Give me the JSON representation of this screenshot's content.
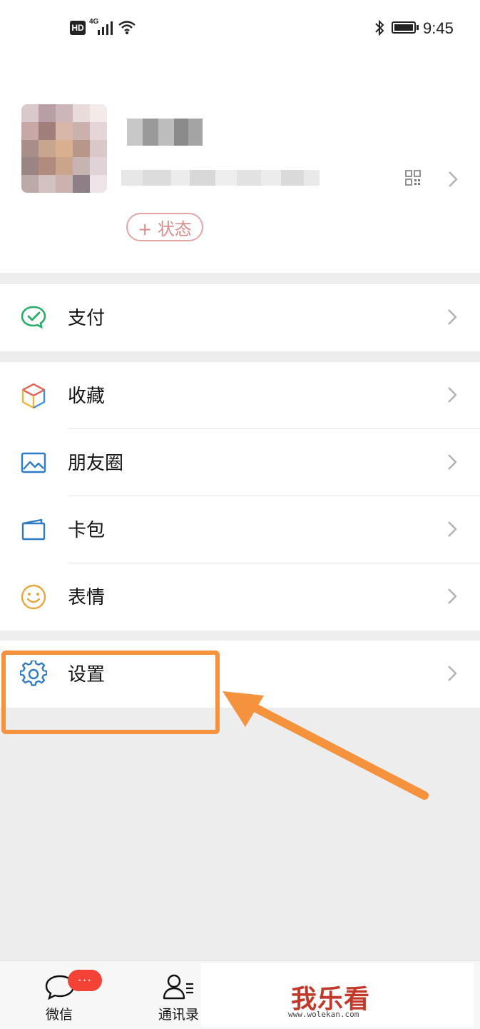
{
  "status_bar": {
    "hd": "HD",
    "network": "4G",
    "time": "9:45"
  },
  "profile": {
    "status_button": "+ 状态",
    "qr_icon": "qr-code-icon",
    "chevron_icon": "chevron-right-icon"
  },
  "menu": {
    "pay": {
      "label": "支付",
      "icon": "wechat-pay-icon",
      "color": "#2aae67"
    },
    "favorites": {
      "label": "收藏",
      "icon": "favorites-cube-icon"
    },
    "moments": {
      "label": "朋友圈",
      "icon": "moments-photo-icon",
      "color": "#2d7bc4"
    },
    "cards": {
      "label": "卡包",
      "icon": "card-wallet-icon",
      "color": "#2d7bc4"
    },
    "stickers": {
      "label": "表情",
      "icon": "smiley-icon",
      "color": "#e7a63b"
    },
    "settings": {
      "label": "设置",
      "icon": "gear-icon",
      "color": "#2d7bc4"
    }
  },
  "bottom_nav": {
    "chats": {
      "label": "微信",
      "badge": "···"
    },
    "contacts": {
      "label": "通讯录"
    }
  },
  "watermark": {
    "logo": "我乐看",
    "url": "www.wolekan.com"
  },
  "annotation": {
    "color": "#f5923e"
  }
}
